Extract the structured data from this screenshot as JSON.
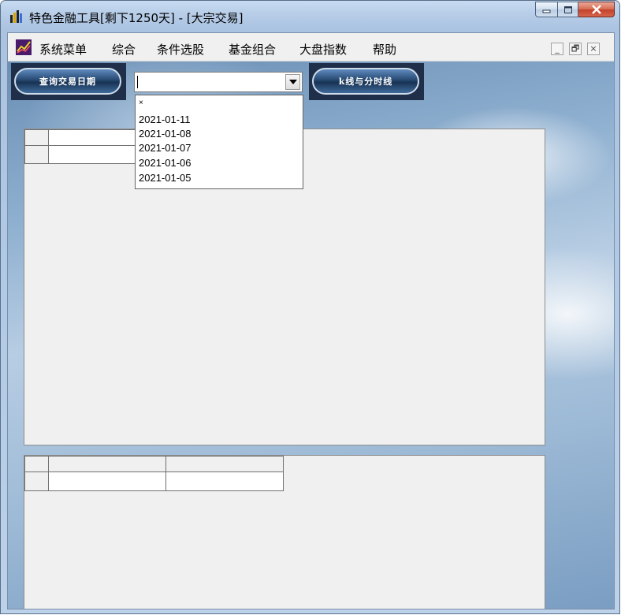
{
  "window": {
    "title": "特色金融工具[剩下1250天] - [大宗交易]",
    "controls": [
      "minimize",
      "maximize",
      "close"
    ]
  },
  "menubar": {
    "items": [
      {
        "label": "系统菜单"
      },
      {
        "label": "综合"
      },
      {
        "label": "条件选股"
      },
      {
        "label": "基金组合"
      },
      {
        "label": "大盘指数"
      },
      {
        "label": "帮助"
      }
    ],
    "mdi_controls": {
      "minimize": "_",
      "restore": "🗗",
      "close": "×"
    }
  },
  "toolbar": {
    "query_button_label": "查询交易日期",
    "kline_button_label": "k线与分时线",
    "date_combo_value": ""
  },
  "dropdown": {
    "options": [
      "×",
      "2021-01-11",
      "2021-01-08",
      "2021-01-07",
      "2021-01-06",
      "2021-01-05"
    ]
  },
  "colors": {
    "title_bar": "#b6cce7",
    "close_button": "#c4402a",
    "client_bg": "#f0f0f0",
    "toolbar_button_bg": "#1f2f4a"
  }
}
